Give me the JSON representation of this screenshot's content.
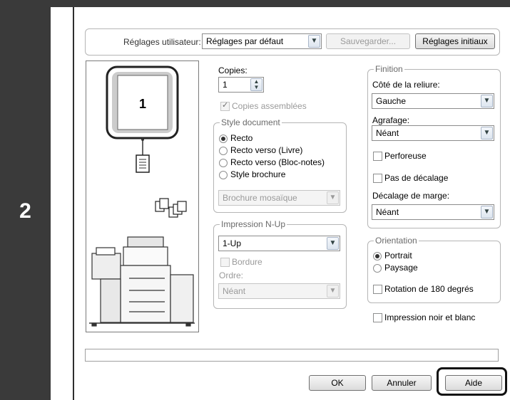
{
  "step": {
    "number": "2"
  },
  "header": {
    "user_settings_label": "Réglages utilisateur:",
    "user_settings_value": "Réglages par défaut",
    "save_button": "Sauvegarder...",
    "initial_settings_button": "Réglages initiaux"
  },
  "preview": {
    "page_number": "1"
  },
  "copies": {
    "label": "Copies:",
    "value": "1",
    "collate_label": "Copies assemblées"
  },
  "document_style": {
    "title": "Style document",
    "options": [
      "Recto",
      "Recto verso (Livre)",
      "Recto verso (Bloc-notes)",
      "Style brochure"
    ],
    "booklet_value": "Brochure mosaïque"
  },
  "nup": {
    "title": "Impression N-Up",
    "value": "1-Up",
    "border_label": "Bordure",
    "order_label": "Ordre:",
    "order_value": "Néant"
  },
  "finishing": {
    "title": "Finition",
    "binding_label": "Côté de la reliure:",
    "binding_value": "Gauche",
    "staple_label": "Agrafage:",
    "staple_value": "Néant",
    "punch_label": "Perforeuse",
    "no_offset_label": "Pas de décalage",
    "margin_shift_label": "Décalage de marge:",
    "margin_shift_value": "Néant"
  },
  "orientation": {
    "title": "Orientation",
    "portrait_label": "Portrait",
    "landscape_label": "Paysage",
    "rotate_label": "Rotation de 180 degrés"
  },
  "bw_label": "Impression noir et blanc",
  "footer": {
    "ok": "OK",
    "cancel": "Annuler",
    "help": "Aide"
  }
}
